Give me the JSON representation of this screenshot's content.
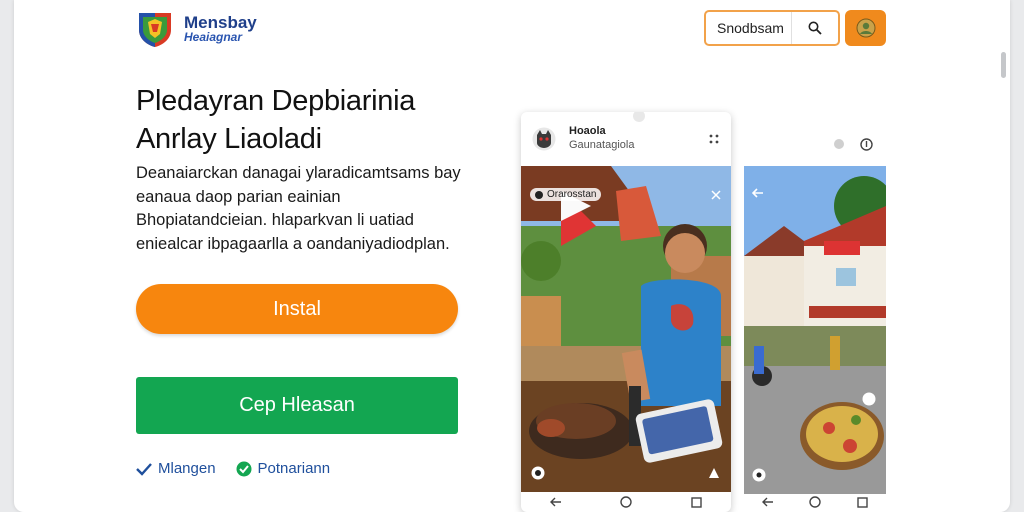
{
  "brand": {
    "name": "Mensbay",
    "sub": "Heaiagnar"
  },
  "search": {
    "text": "Snodbsam"
  },
  "hero": {
    "title_line1": "Pledayran Depbiarinia",
    "title_line2": "Anrlay Liaoladi",
    "description": "Deanaiarckan danagai ylaradicamtsams bay eanaua daop parian eainian Bhopiatandcieian. hlaparkvan li uatiad eniealcar ibpagaarlla a oandaniyadiodplan."
  },
  "buttons": {
    "install": "Instal",
    "secondary": "Cep Hleasan"
  },
  "features": [
    {
      "label": "Mlangen",
      "icon": "check-icon"
    },
    {
      "label": "Potnariann",
      "icon": "badge-check-icon"
    }
  ],
  "phone1": {
    "title": "Hoaola",
    "subtitle": "Gaunatagiola",
    "tag": "Orarosstan"
  },
  "colors": {
    "accent_orange": "#f7860e",
    "accent_green": "#13a651",
    "brand_blue": "#1f3f8a"
  }
}
